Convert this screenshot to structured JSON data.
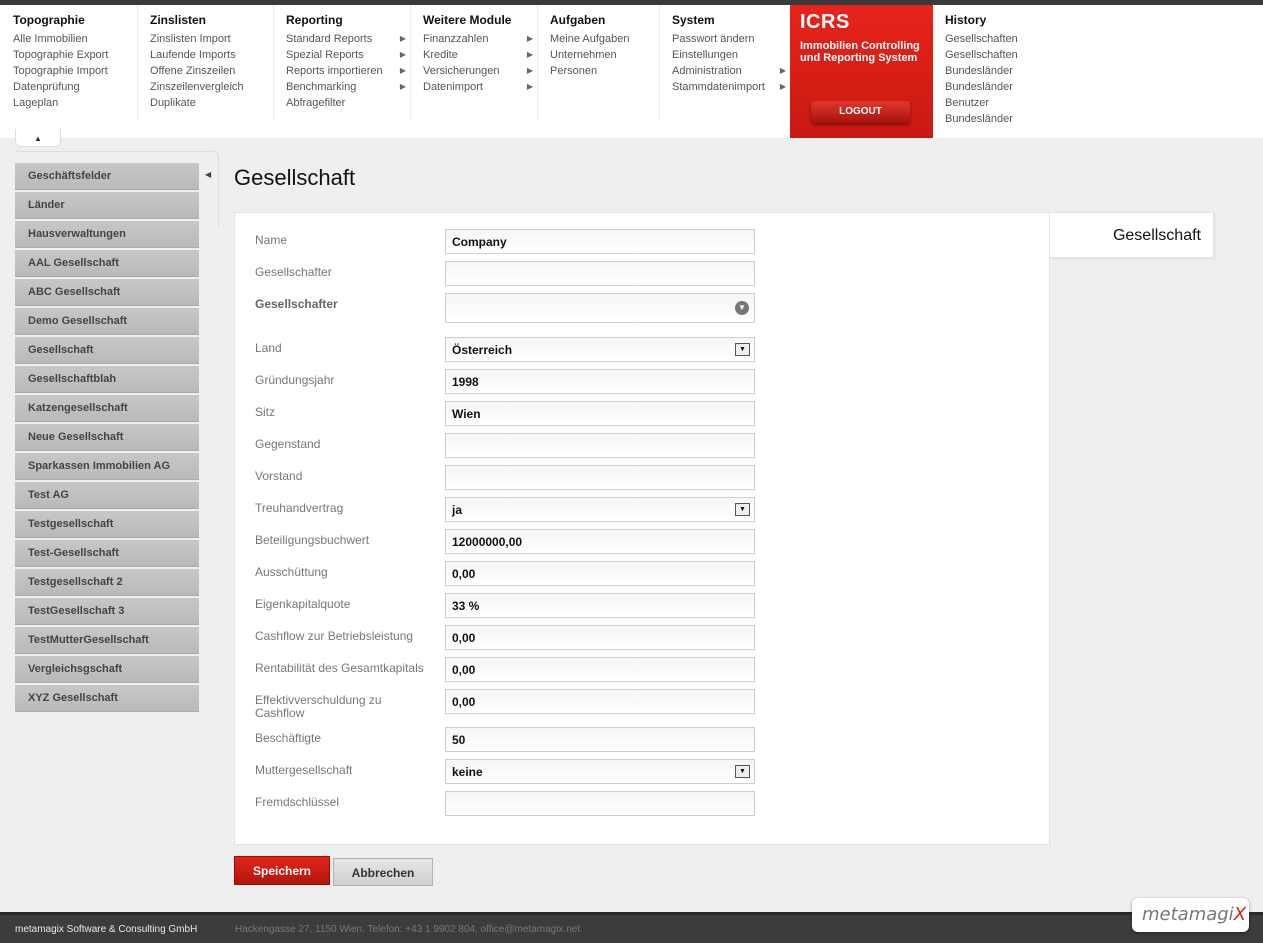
{
  "menu": [
    {
      "title": "Topographie",
      "items": [
        {
          "label": "Alle Immobilien"
        },
        {
          "label": "Topographie Export"
        },
        {
          "label": "Topographie Import"
        },
        {
          "label": "Datenprüfung"
        },
        {
          "label": "Lageplan"
        }
      ]
    },
    {
      "title": "Zinslisten",
      "items": [
        {
          "label": "Zinslisten Import"
        },
        {
          "label": "Laufende Imports"
        },
        {
          "label": "Offene Zinszeilen"
        },
        {
          "label": "Zinszeilenvergleich"
        },
        {
          "label": "Duplikate"
        }
      ]
    },
    {
      "title": "Reporting",
      "items": [
        {
          "label": "Standard Reports"
        },
        {
          "label": "Spezial Reports"
        },
        {
          "label": "Reports importieren"
        },
        {
          "label": "Benchmarking"
        },
        {
          "label": "Abfragefilter"
        }
      ]
    },
    {
      "title": "Weitere Module",
      "items": [
        {
          "label": "Finanzzahlen"
        },
        {
          "label": "Kredite"
        },
        {
          "label": "Versicherungen"
        },
        {
          "label": "Datenimport"
        }
      ]
    },
    {
      "title": "Aufgaben",
      "items": [
        {
          "label": "Meine Aufgaben"
        },
        {
          "label": "Unternehmen"
        },
        {
          "label": "Personen"
        }
      ]
    },
    {
      "title": "System",
      "items": [
        {
          "label": "Passwort ändern"
        },
        {
          "label": "Einstellungen"
        },
        {
          "label": "Administration"
        },
        {
          "label": "Stammdatenimport"
        }
      ]
    },
    {
      "title": "History",
      "items": [
        {
          "label": "Gesellschaften"
        },
        {
          "label": "Gesellschaften"
        },
        {
          "label": "Bundesländer"
        },
        {
          "label": "Bundesländer"
        },
        {
          "label": "Benutzer"
        },
        {
          "label": "Bundesländer"
        }
      ]
    }
  ],
  "brand": {
    "name": "ICRS",
    "subtitle": "Immobilien Controlling und Reporting System",
    "logout_label": "LOGOUT",
    "accent": "#d91f16"
  },
  "sidebar": {
    "items": [
      {
        "label": "Geschäftsfelder"
      },
      {
        "label": "Länder"
      },
      {
        "label": "Hausverwaltungen"
      },
      {
        "label": "AAL Gesellschaft"
      },
      {
        "label": "ABC Gesellschaft"
      },
      {
        "label": "Demo Gesellschaft"
      },
      {
        "label": "Gesellschaft"
      },
      {
        "label": "Gesellschaftblah"
      },
      {
        "label": "Katzengesellschaft"
      },
      {
        "label": "Neue Gesellschaft"
      },
      {
        "label": "Sparkassen Immobilien AG"
      },
      {
        "label": "Test AG"
      },
      {
        "label": "Testgesellschaft"
      },
      {
        "label": "Test-Gesellschaft"
      },
      {
        "label": "Testgesellschaft 2"
      },
      {
        "label": "TestGesellschaft 3"
      },
      {
        "label": "TestMutterGesellschaft"
      },
      {
        "label": "Vergleichsgschaft"
      },
      {
        "label": "XYZ Gesellschaft"
      }
    ]
  },
  "page": {
    "title": "Gesellschaft",
    "panel_tab": "Gesellschaft"
  },
  "form": {
    "fields": [
      {
        "label": "Name",
        "value": "Company"
      },
      {
        "label": "Gesellschafter",
        "value": ""
      },
      {
        "label": "Gesellschafter",
        "value": ""
      },
      {
        "label": "Land",
        "value": "Österreich"
      },
      {
        "label": "Gründungsjahr",
        "value": "1998"
      },
      {
        "label": "Sitz",
        "value": "Wien"
      },
      {
        "label": "Gegenstand",
        "value": ""
      },
      {
        "label": "Vorstand",
        "value": ""
      },
      {
        "label": "Treuhandvertrag",
        "value": "ja"
      },
      {
        "label": "Beteiligungsbuchwert",
        "value": "12000000,00"
      },
      {
        "label": "Ausschüttung",
        "value": "0,00"
      },
      {
        "label": "Eigenkapitalquote",
        "value": "33 %"
      },
      {
        "label": "Cashflow zur Betriebsleistung",
        "value": "0,00"
      },
      {
        "label": "Rentabilität des Gesamtkapitals",
        "value": "0,00"
      },
      {
        "label": "Effektivverschuldung zu Cashflow",
        "value": "0,00"
      },
      {
        "label": "Beschäftigte",
        "value": "50"
      },
      {
        "label": "Muttergesellschaft",
        "value": "keine"
      },
      {
        "label": "Fremdschlüssel",
        "value": ""
      }
    ]
  },
  "actions": {
    "save": "Speichern",
    "cancel": "Abbrechen"
  },
  "footer": {
    "company": "metamagix Software & Consulting GmbH",
    "address": "Hackengasse 27, 1150 Wien, Telefon: +43 1 9902 804, office@metamagix.net",
    "logo_text": "metamagi",
    "logo_x": "X"
  }
}
